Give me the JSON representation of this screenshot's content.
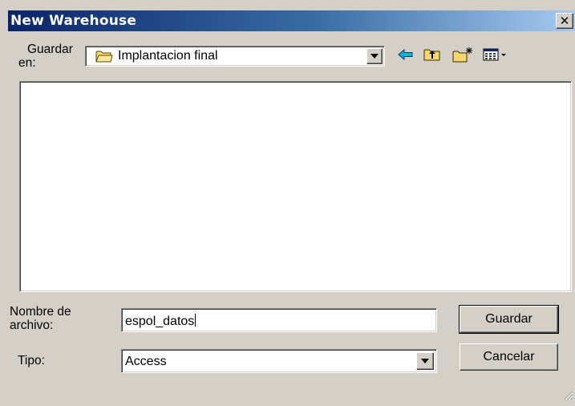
{
  "window": {
    "title": "New Warehouse",
    "close_glyph": "✕"
  },
  "location": {
    "label_line1": "Guardar",
    "label_line2": "en:",
    "value": "Implantacion final",
    "icon": "folder-icon"
  },
  "toolbar": {
    "icons": [
      "back-arrow-icon",
      "up-folder-icon",
      "new-folder-icon",
      "view-menu-icon"
    ]
  },
  "file_list": {
    "items": []
  },
  "filename": {
    "label_line1": "Nombre de",
    "label_line2": "archivo:",
    "value": "espol_datos"
  },
  "filetype": {
    "label": "Tipo:",
    "value": "Access"
  },
  "buttons": {
    "save": "Guardar",
    "cancel": "Cancelar"
  },
  "colors": {
    "titlebar_start": "#0a246a",
    "titlebar_end": "#a6caf0",
    "face": "#d4d0c8",
    "accent_arrow": "#00b4d8",
    "folder": "#f5d76e"
  }
}
